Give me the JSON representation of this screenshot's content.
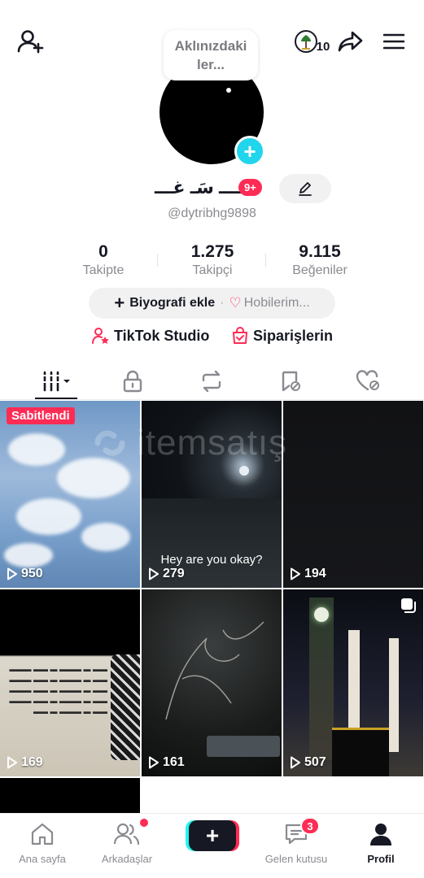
{
  "header": {
    "coin_count": "10",
    "bubble_text": "Aklınızdaki ler..."
  },
  "profile": {
    "name": "ـــــ سَـ غـــ",
    "notification_badge": "9+",
    "username": "@dytribhg9898"
  },
  "stats": [
    {
      "value": "0",
      "label": "Takipte"
    },
    {
      "value": "1.275",
      "label": "Takipçi"
    },
    {
      "value": "9.115",
      "label": "Beğeniler"
    }
  ],
  "bio": {
    "add_bio_label": "Biyografi ekle",
    "separator": "·",
    "hobbies_label": "Hobilerim..."
  },
  "links": {
    "studio_label": "TikTok Studio",
    "orders_label": "Siparişlerin"
  },
  "tabs": [
    "videos-grid",
    "private",
    "reposts",
    "favorites",
    "liked"
  ],
  "videos": [
    {
      "views": "950",
      "pinned_label": "Sabitlendi"
    },
    {
      "views": "279",
      "caption": "Hey are you okay?"
    },
    {
      "views": "194"
    },
    {
      "views": "169"
    },
    {
      "views": "161"
    },
    {
      "views": "507"
    }
  ],
  "watermark": "itemsatış",
  "bottom_nav": {
    "home": "Ana sayfa",
    "friends": "Arkadaşlar",
    "inbox": "Gelen kutusu",
    "inbox_badge": "3",
    "profile": "Profil"
  },
  "colors": {
    "accent": "#fe2c55",
    "cyan": "#20d5ec",
    "text": "#161823",
    "muted": "#8a8b91"
  }
}
